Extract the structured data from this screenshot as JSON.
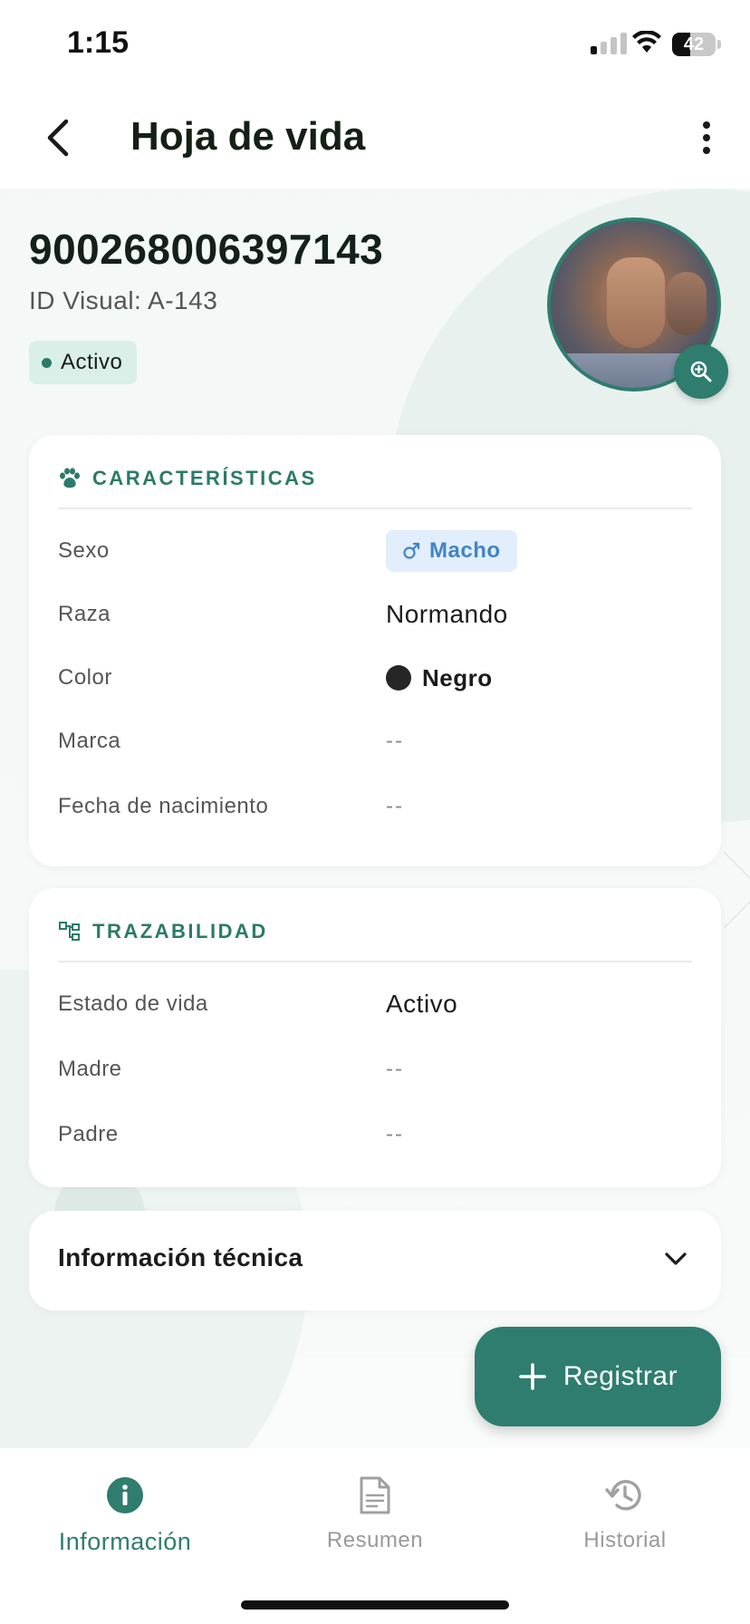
{
  "status_bar": {
    "time": "1:15",
    "battery": "42"
  },
  "header": {
    "title": "Hoja de vida",
    "back_icon": "chevron-left-icon",
    "menu_icon": "more-vertical-icon"
  },
  "animal": {
    "id": "900268006397143",
    "visual_id": "ID Visual: A-143",
    "status": "Activo",
    "status_color": "#2b7a6a",
    "photo_icon": "zoom-in-icon"
  },
  "caracteristicas": {
    "title": "CARACTERÍSTICAS",
    "icon": "paw-icon",
    "rows": {
      "sexo": {
        "label": "Sexo",
        "value": "Macho",
        "icon": "male-icon"
      },
      "raza": {
        "label": "Raza",
        "value": "Normando"
      },
      "color": {
        "label": "Color",
        "value": "Negro",
        "swatch": "#262626"
      },
      "marca": {
        "label": "Marca",
        "value": "--"
      },
      "nacimiento": {
        "label": "Fecha de nacimiento",
        "value": "--"
      }
    }
  },
  "trazabilidad": {
    "title": "TRAZABILIDAD",
    "icon": "hierarchy-icon",
    "rows": {
      "estado": {
        "label": "Estado de vida",
        "value": "Activo"
      },
      "madre": {
        "label": "Madre",
        "value": "--"
      },
      "padre": {
        "label": "Padre",
        "value": "--"
      }
    }
  },
  "informacion_tecnica": {
    "title": "Información técnica",
    "icon": "chevron-down-icon"
  },
  "fab": {
    "label": "Registrar",
    "icon": "plus-icon"
  },
  "bottom_nav": {
    "items": [
      {
        "label": "Información",
        "icon": "info-icon",
        "active": true
      },
      {
        "label": "Resumen",
        "icon": "document-icon",
        "active": false
      },
      {
        "label": "Historial",
        "icon": "history-icon",
        "active": false
      }
    ]
  },
  "colors": {
    "primary": "#2e7d6e",
    "male_chip_bg": "#e2eefb",
    "male_chip_text": "#3f84c8"
  }
}
